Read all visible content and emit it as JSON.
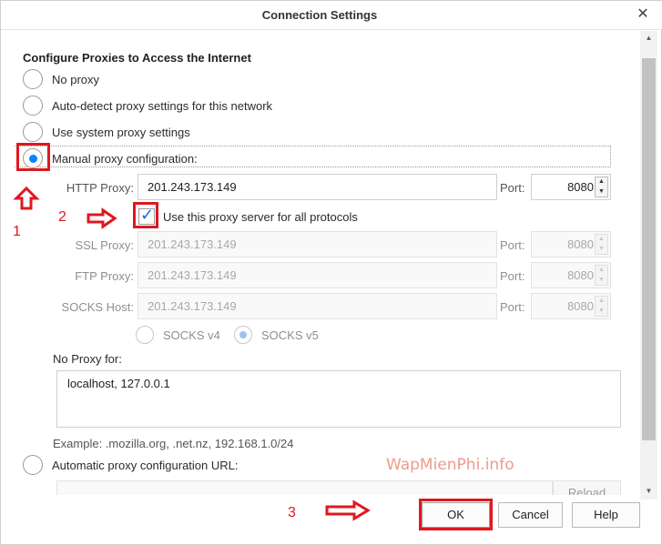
{
  "window": {
    "title": "Connection Settings",
    "close_glyph": "✕"
  },
  "section": {
    "heading": "Configure Proxies to Access the Internet"
  },
  "proxy_options": [
    {
      "label": "No proxy",
      "checked": false
    },
    {
      "label": "Auto-detect proxy settings for this network",
      "checked": false
    },
    {
      "label": "Use system proxy settings",
      "checked": false
    },
    {
      "label": "Manual proxy configuration:",
      "checked": true
    }
  ],
  "manual": {
    "http": {
      "label": "HTTP Proxy:",
      "value": "201.243.173.149",
      "port_label": "Port:",
      "port": "8080"
    },
    "use_for_all": {
      "label": "Use this proxy server for all protocols",
      "checked": true
    },
    "ssl": {
      "label": "SSL Proxy:",
      "value": "201.243.173.149",
      "port_label": "Port:",
      "port": "8080"
    },
    "ftp": {
      "label": "FTP Proxy:",
      "value": "201.243.173.149",
      "port_label": "Port:",
      "port": "8080"
    },
    "socks": {
      "label": "SOCKS Host:",
      "value": "201.243.173.149",
      "port_label": "Port:",
      "port": "8080"
    },
    "socks_v4": {
      "label": "SOCKS v4",
      "checked": false
    },
    "socks_v5": {
      "label": "SOCKS v5",
      "checked": true
    }
  },
  "no_proxy": {
    "label": "No Proxy for:",
    "value": "localhost, 127.0.0.1",
    "example": "Example: .mozilla.org, .net.nz, 192.168.1.0/24"
  },
  "pac": {
    "label": "Automatic proxy configuration URL:",
    "value": "",
    "reload_label": "Reload"
  },
  "buttons": {
    "ok": "OK",
    "cancel": "Cancel",
    "help": "Help"
  },
  "annotations": {
    "step1": "1",
    "step2": "2",
    "step3": "3",
    "color": "#e0171f"
  },
  "watermark": "WapMienPhi.info",
  "colors": {
    "accent": "#0a84ff",
    "annotation": "#e0171f",
    "watermark": "#ee9080"
  },
  "icons": {
    "close": "close-icon",
    "spinner_up": "chevron-up-icon",
    "spinner_down": "chevron-down-icon",
    "scroll_up": "scroll-up-icon",
    "scroll_down": "scroll-down-icon",
    "checkmark": "checkmark-icon",
    "arrow": "red-arrow-icon"
  }
}
